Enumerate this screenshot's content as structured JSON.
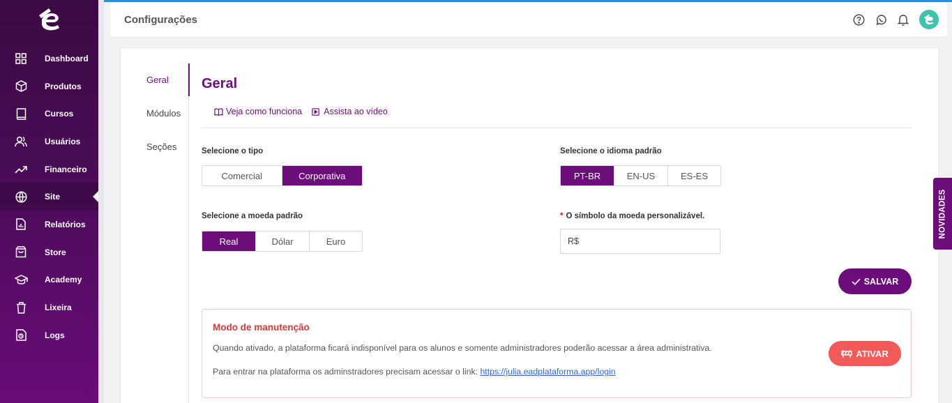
{
  "sidebar": {
    "items": [
      {
        "label": "Dashboard",
        "icon": "grid-icon"
      },
      {
        "label": "Produtos",
        "icon": "box-icon"
      },
      {
        "label": "Cursos",
        "icon": "book-icon"
      },
      {
        "label": "Usuários",
        "icon": "users-icon"
      },
      {
        "label": "Financeiro",
        "icon": "trending-up-icon"
      },
      {
        "label": "Site",
        "icon": "globe-icon"
      },
      {
        "label": "Relatórios",
        "icon": "report-icon"
      },
      {
        "label": "Store",
        "icon": "shopping-bag-icon"
      },
      {
        "label": "Academy",
        "icon": "graduation-cap-icon"
      },
      {
        "label": "Lixeira",
        "icon": "trash-icon"
      },
      {
        "label": "Logs",
        "icon": "logs-icon"
      }
    ],
    "active": "Site"
  },
  "header": {
    "title": "Configurações",
    "icons": [
      "help-icon",
      "whatsapp-icon",
      "bell-icon",
      "avatar"
    ]
  },
  "tabs": [
    {
      "label": "Geral"
    },
    {
      "label": "Módulos"
    },
    {
      "label": "Seções"
    }
  ],
  "section": {
    "title": "Geral",
    "link_how": "Veja como funciona",
    "link_video": "Assista ao vídeo"
  },
  "type": {
    "label": "Selecione o tipo",
    "options": [
      "Comercial",
      "Corporativa"
    ],
    "selected": "Corporativa"
  },
  "language": {
    "label": "Selecione o idioma padrão",
    "options": [
      "PT-BR",
      "EN-US",
      "ES-ES"
    ],
    "selected": "PT-BR"
  },
  "currency": {
    "label": "Selecione a moeda padrão",
    "options": [
      "Real",
      "Dólar",
      "Euro"
    ],
    "selected": "Real"
  },
  "symbol": {
    "required_mark": "*",
    "label": "O símbolo da moeda personalizável.",
    "value": "R$"
  },
  "save_label": "SALVAR",
  "maintenance": {
    "title": "Modo de manutenção",
    "description": "Quando ativado, a plataforma ficará indisponível para os alunos e somente administradores poderão acessar a área administrativa.",
    "link_prefix": "Para entrar na plataforma os adminstradores precisam acessar o link: ",
    "link": "https://julia.eadplataforma.app/login",
    "button": "ATIVAR"
  },
  "novidades": "NOVIDADES",
  "colors": {
    "primary": "#6c0d7b",
    "danger": "#f25a5a",
    "teal": "#3fc2b0"
  }
}
